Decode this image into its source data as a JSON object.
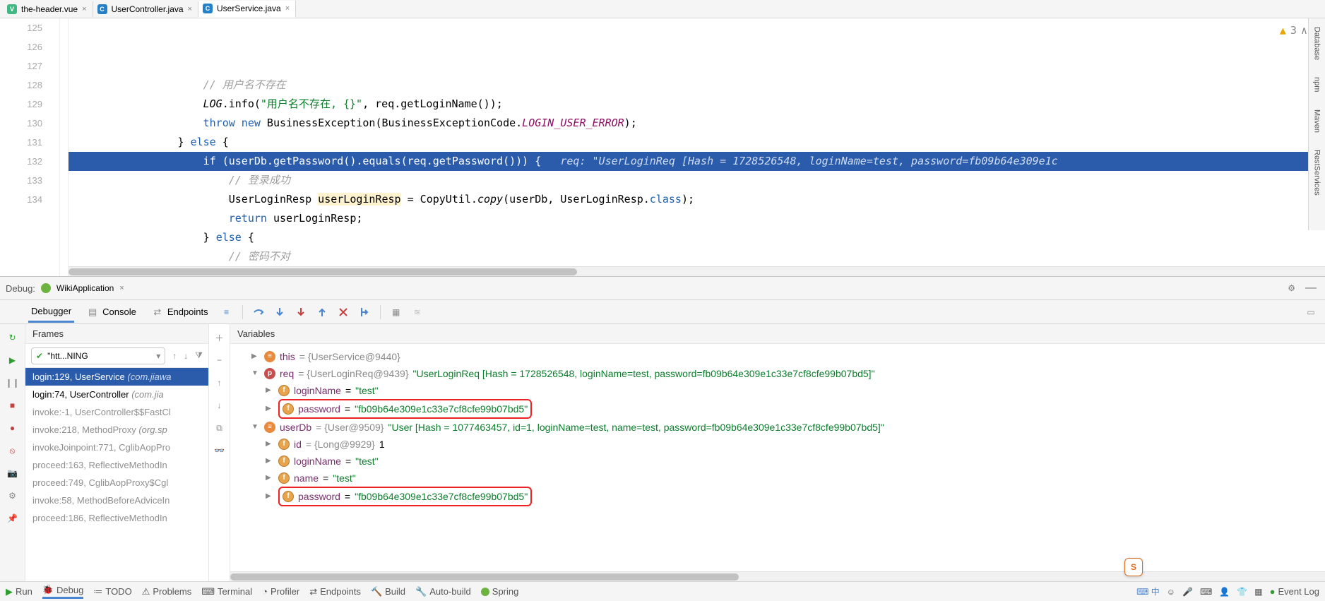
{
  "tabs": [
    {
      "name": "the-header.vue",
      "kind": "vue",
      "active": false
    },
    {
      "name": "UserController.java",
      "kind": "cls",
      "active": false
    },
    {
      "name": "UserService.java",
      "kind": "cls",
      "active": true
    }
  ],
  "editor": {
    "warn_count": "3",
    "lines": [
      {
        "n": "125",
        "indent": 5,
        "type": "cmt",
        "text": "// 用户名不存在"
      },
      {
        "n": "126",
        "raw": "<span class='c-static'>LOG</span>.info(<span class='c-str'>\"用户名不存在, {}\"</span>, req.getLoginName());",
        "indent": 5
      },
      {
        "n": "127",
        "raw": "<span class='c-kw'>throw new</span> BusinessException(BusinessExceptionCode.<span class='c-enum'>LOGIN_USER_ERROR</span>);",
        "indent": 5
      },
      {
        "n": "128",
        "raw": "} <span class='c-kw'>else</span> {",
        "indent": 4
      },
      {
        "n": "129",
        "sel": true,
        "raw": "<span class='c-kw'>if</span> (userDb.getPassword().equals(req.getPassword())) {   <span class='c-inlhint'>req: \"UserLoginReq [Hash = 1728526548, loginName=test, password=fb09b64e309e1c</span>",
        "indent": 5
      },
      {
        "n": "130",
        "indent": 6,
        "type": "cmt",
        "text": "// 登录成功"
      },
      {
        "n": "131",
        "raw": "UserLoginResp <span class='c-hl'>userLoginResp</span> = CopyUtil.<span class='c-static'>copy</span>(userDb, UserLoginResp.<span class='c-kw'>class</span>);",
        "indent": 6
      },
      {
        "n": "132",
        "raw": "<span class='c-kw'>return</span> userLoginResp;",
        "indent": 6
      },
      {
        "n": "133",
        "raw": "} <span class='c-kw'>else</span> {",
        "indent": 5
      },
      {
        "n": "134",
        "indent": 6,
        "type": "cmt",
        "text": "// 密码不对"
      }
    ]
  },
  "debug": {
    "title_prefix": "Debug:",
    "config": "WikiApplication",
    "tabs": {
      "debugger": "Debugger",
      "console": "Console",
      "endpoints": "Endpoints"
    },
    "frames_label": "Frames",
    "vars_label": "Variables",
    "thread_sel": "\"htt...NING",
    "frames": [
      {
        "txt": "login:129, UserService",
        "pkg": "(com.jiawa",
        "selected": true
      },
      {
        "txt": "login:74, UserController",
        "pkg": "(com.jia"
      },
      {
        "txt": "invoke:-1, UserController$$FastCl",
        "lib": true
      },
      {
        "txt": "invoke:218, MethodProxy",
        "pkg": "(org.sp",
        "lib": true
      },
      {
        "txt": "invokeJoinpoint:771, CglibAopPro",
        "lib": true
      },
      {
        "txt": "proceed:163, ReflectiveMethodIn",
        "lib": true
      },
      {
        "txt": "proceed:749, CglibAopProxy$Cgl",
        "lib": true
      },
      {
        "txt": "invoke:58, MethodBeforeAdviceIn",
        "lib": true
      },
      {
        "txt": "proceed:186, ReflectiveMethodIn",
        "lib": true
      }
    ],
    "vars": [
      {
        "d": 1,
        "exp": "▶",
        "badge": "b-orange",
        "bch": "≡",
        "key": "this",
        "grey": "= {UserService@9440}"
      },
      {
        "d": 1,
        "exp": "▼",
        "badge": "b-red",
        "bch": "p",
        "key": "req",
        "grey": "= {UserLoginReq@9439}",
        "str": " \"UserLoginReq [Hash = 1728526548, loginName=test, password=fb09b64e309e1c33e7cf8cfe99b07bd5]\""
      },
      {
        "d": 2,
        "exp": "▶",
        "badge": "b-f",
        "bch": "f",
        "key": "loginName",
        "plain": " = ",
        "str": "\"test\""
      },
      {
        "d": 2,
        "exp": "▶",
        "badge": "b-f",
        "bch": "f",
        "key": "password",
        "plain": " = ",
        "str": "\"fb09b64e309e1c33e7cf8cfe99b07bd5\"",
        "box": true
      },
      {
        "d": 1,
        "exp": "▼",
        "badge": "b-orange",
        "bch": "≡",
        "key": "userDb",
        "grey": "= {User@9509}",
        "str": " \"User [Hash = 1077463457, id=1, loginName=test, name=test, password=fb09b64e309e1c33e7cf8cfe99b07bd5]\""
      },
      {
        "d": 2,
        "exp": "▶",
        "badge": "b-f",
        "bch": "f",
        "key": "id",
        "grey": "= {Long@9929}",
        "plain": " 1"
      },
      {
        "d": 2,
        "exp": "▶",
        "badge": "b-f",
        "bch": "f",
        "key": "loginName",
        "plain": " = ",
        "str": "\"test\""
      },
      {
        "d": 2,
        "exp": "▶",
        "badge": "b-f",
        "bch": "f",
        "key": "name",
        "plain": " = ",
        "str": "\"test\""
      },
      {
        "d": 2,
        "exp": "▶",
        "badge": "b-f",
        "bch": "f",
        "key": "password",
        "plain": " = ",
        "str": "\"fb09b64e309e1c33e7cf8cfe99b07bd5\"",
        "box": true
      }
    ]
  },
  "status": {
    "run": "Run",
    "debug": "Debug",
    "todo": "TODO",
    "problems": "Problems",
    "terminal": "Terminal",
    "profiler": "Profiler",
    "endpoints": "Endpoints",
    "build": "Build",
    "autobuild": "Auto-build",
    "spring": "Spring",
    "event_log": "Event Log",
    "ime": "中"
  },
  "side_tabs": {
    "database": "Database",
    "npm": "npm",
    "maven": "Maven",
    "rest": "RestServices"
  }
}
